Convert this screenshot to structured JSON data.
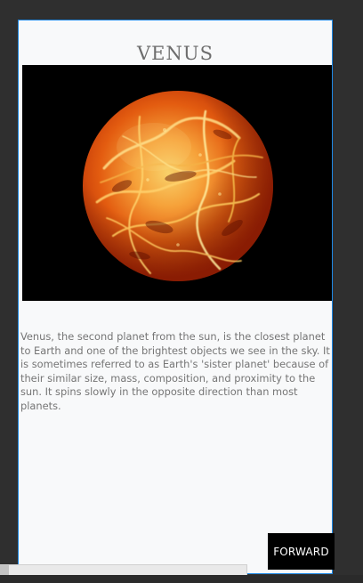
{
  "page": {
    "title": "VENUS",
    "description": "Venus, the second planet from the sun, is the closest planet to Earth and one of the brightest objects we see in the sky. It is sometimes referred to as Earth's 'sister planet' because of their similar size, mass, composition, and proximity to the sun. It spins slowly in the opposite direction than most planets.",
    "forward_label": "FORWARD"
  },
  "image": {
    "semantic": "venus-planet-image",
    "background_color": "#000000",
    "planet_colors": [
      "#f6c15a",
      "#f2821e",
      "#c83a06",
      "#6d1300"
    ]
  },
  "colors": {
    "frame_border": "#1e88e5",
    "frame_background": "#f8f9fa",
    "title": "#6d6d6d",
    "description_text": "#757575",
    "button_background": "#000000",
    "button_text": "#ffffff",
    "outer_background": "#2f2f2f"
  }
}
